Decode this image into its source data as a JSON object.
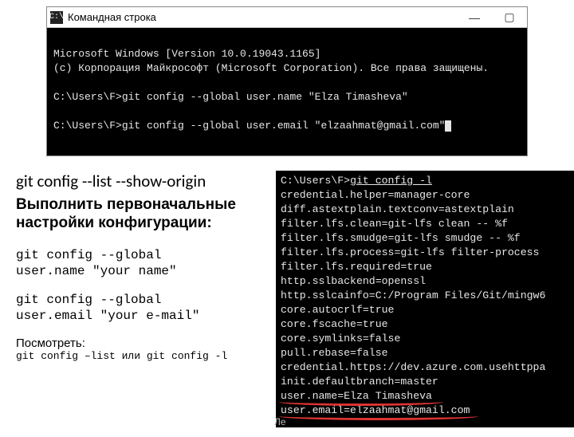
{
  "window": {
    "icon_glyph": "C:\\",
    "title": "Командная строка",
    "minimize": "—",
    "maximize": "▢"
  },
  "term_top": {
    "l0": "Microsoft Windows [Version 10.0.19043.1165]",
    "l1": "(c) Корпорация Майкрософт (Microsoft Corporation). Все права защищены.",
    "l2": "",
    "l3": "C:\\Users\\F>git config --global user.name \"Elza Timasheva\"",
    "l4": "",
    "l5": "C:\\Users\\F>git config --global user.email \"elzaahmat@gmail.com\""
  },
  "left": {
    "heading": "git config --list --show-origin",
    "subheading": "Выполнить первоначальные настройки конфигурации:",
    "snippet1": "git config --global\nuser.name \"your name\"",
    "snippet2": "git config --global\nuser.email \"your e-mail\"",
    "see_label": "Посмотреть:",
    "see_cmd": "git config –list или git config -l"
  },
  "term_right": {
    "prompt": "C:\\Users\\F>",
    "cmd": "git config -l",
    "lines": [
      "credential.helper=manager-core",
      "diff.astextplain.textconv=astextplain",
      "filter.lfs.clean=git-lfs clean -- %f",
      "filter.lfs.smudge=git-lfs smudge -- %f",
      "filter.lfs.process=git-lfs filter-process",
      "filter.lfs.required=true",
      "http.sslbackend=openssl",
      "http.sslcainfo=C:/Program Files/Git/mingw6",
      "core.autocrlf=true",
      "core.fscache=true",
      "core.symlinks=false",
      "pull.rebase=false",
      "credential.https://dev.azure.com.usehttppa",
      "init.defaultbranch=master",
      "user.name=Elza Timasheva",
      "user.email=elzaahmat@gmail.com"
    ]
  },
  "footer_faded": "Ле"
}
